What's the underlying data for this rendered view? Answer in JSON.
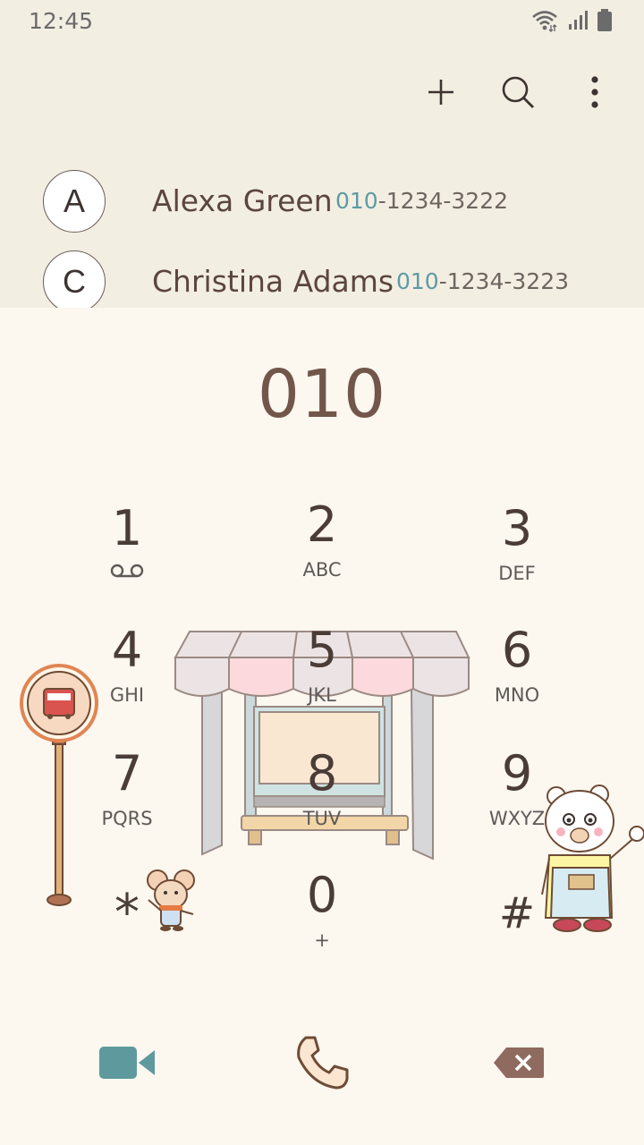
{
  "status_bar": {
    "time": "12:45"
  },
  "toolbar": {
    "add_icon": "plus-icon",
    "search_icon": "search-icon",
    "more_icon": "more-vertical-icon"
  },
  "contacts": [
    {
      "initial": "A",
      "name": "Alexa Green",
      "number_match": "010",
      "number_rest": "-1234-3222"
    },
    {
      "initial": "C",
      "name": "Christina Adams",
      "number_match": "010",
      "number_rest": "-1234-3223"
    }
  ],
  "dialer": {
    "display": "010",
    "keys": [
      {
        "digit": "1",
        "letters": ""
      },
      {
        "digit": "2",
        "letters": "ABC"
      },
      {
        "digit": "3",
        "letters": "DEF"
      },
      {
        "digit": "4",
        "letters": "GHI"
      },
      {
        "digit": "5",
        "letters": "JKL"
      },
      {
        "digit": "6",
        "letters": "MNO"
      },
      {
        "digit": "7",
        "letters": "PQRS"
      },
      {
        "digit": "8",
        "letters": "TUV"
      },
      {
        "digit": "9",
        "letters": "WXYZ"
      },
      {
        "digit": "*",
        "letters": ""
      },
      {
        "digit": "0",
        "letters": "+"
      },
      {
        "digit": "#",
        "letters": ""
      }
    ]
  },
  "bottom_bar": {
    "video_icon": "video-call-icon",
    "call_icon": "phone-icon",
    "delete_icon": "backspace-icon"
  },
  "colors": {
    "background": "#fcf7ef",
    "top_background": "#f3eee2",
    "text": "#5b463e",
    "number_highlight": "#5f9aa4",
    "video_icon": "#5e9a9d",
    "delete_icon": "#8f6a5f"
  }
}
